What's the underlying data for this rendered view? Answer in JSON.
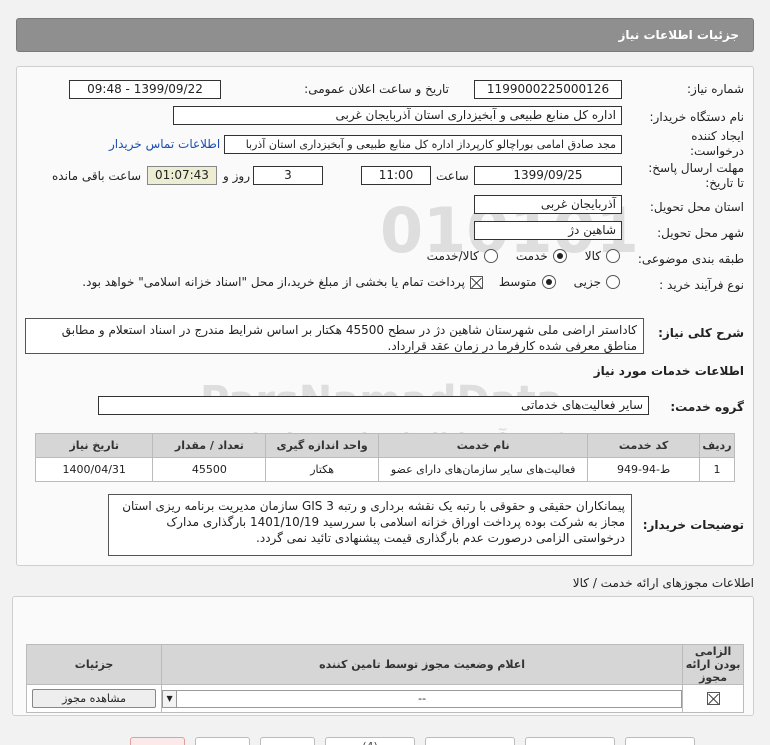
{
  "header": {
    "title": "جزئیات اطلاعات نیاز"
  },
  "form": {
    "need_number": {
      "label": "شماره نیاز:",
      "value": "1199000225000126"
    },
    "announce_datetime": {
      "label": "تاریخ و ساعت اعلان عمومی:",
      "value": "1399/09/22 - 09:48"
    },
    "buyer_org": {
      "label": "نام دستگاه خریدار:",
      "value": "اداره کل منابع طبیعی و آبخیزداری استان آذربایجان غربی"
    },
    "requester": {
      "label_line1": "ایجاد کننده",
      "label_line2": "درخواست:",
      "value": "مجد صادق امامی بوراچالو کارپرداز اداره کل منابع طبیعی و آبخیزداری استان آذربا",
      "contact_link": "اطلاعات تماس خریدار"
    },
    "deadline": {
      "label_line1": "مهلت ارسال پاسخ:",
      "label_line2": "تا تاریخ:",
      "date": "1399/09/25",
      "time_label": "ساعت",
      "time": "11:00",
      "days": "3",
      "days_label": "روز و",
      "remaining": "01:07:43",
      "remaining_label": "ساعت باقی مانده"
    },
    "delivery_province": {
      "label": "استان محل تحویل:",
      "value": "آذربایجان غربی"
    },
    "delivery_city": {
      "label": "شهر محل تحویل:",
      "value": "شاهین دژ"
    },
    "category": {
      "label": "طبقه بندی موضوعی:",
      "options": [
        "کالا",
        "خدمت",
        "کالا/خدمت"
      ],
      "selected": "خدمت"
    },
    "purchase_type": {
      "label": "نوع فرآیند خرید :",
      "options": [
        "جزیی",
        "متوسط"
      ],
      "selected": "متوسط",
      "payment_note": "پرداخت تمام یا بخشی از مبلغ خرید،از محل \"اسناد خزانه اسلامی\" خواهد بود."
    }
  },
  "summary": {
    "label": "شرح کلی نیاز:",
    "text": "کاداستر اراضی ملی شهرستان شاهین دژ در سطح 45500 هکتار بر اساس شرایط مندرج در اسناد استعلام و مطابق مناطق معرفی شده کارفرما در زمان عقد قرارداد."
  },
  "services": {
    "section_title": "اطلاعات خدمات مورد نیاز",
    "group_label": "گروه خدمت:",
    "group_value": "سایر فعالیت‌های خدماتی",
    "columns": [
      "ردیف",
      "کد خدمت",
      "نام خدمت",
      "واحد اندازه گیری",
      "تعداد / مقدار",
      "تاریخ نیاز"
    ],
    "rows": [
      [
        "1",
        "ط-94-949",
        "فعالیت‌های سایر سازمان‌های دارای عضو",
        "هکتار",
        "45500",
        "1400/04/31"
      ]
    ]
  },
  "buyer_notes": {
    "label": "توضیحات خریدار:",
    "text": "پیمانکاران حقیقی و حقوقی با رتبه یک نقشه برداری و رتبه 3 GIS سازمان مدیریت برنامه ریزی استان مجاز به شرکت بوده پرداخت  اوراق خزانه اسلامی با سررسید 1401/10/19 بارگذاری مدارک درخواستی الزامی درصورت عدم بارگذاری قیمت پیشنهادی تائید نمی گردد."
  },
  "permits": {
    "section_title": "اطلاعات مجوزهای ارائه خدمت / کالا",
    "columns": [
      "الزامی بودن ارائه مجوز",
      "اعلام وضعیت مجوز توسط تامین کننده",
      "جزئیات"
    ],
    "row": {
      "required": true,
      "status": "--",
      "details_button": "مشاهده مجوز"
    }
  },
  "bottom_buttons": [
    "",
    "",
    "",
    "(4)",
    "",
    "",
    "",
    ""
  ],
  "watermark": {
    "line1": "ParsNamadData",
    "line2": "مرکز فرآیند اطلاعات پارس نماد داده"
  }
}
